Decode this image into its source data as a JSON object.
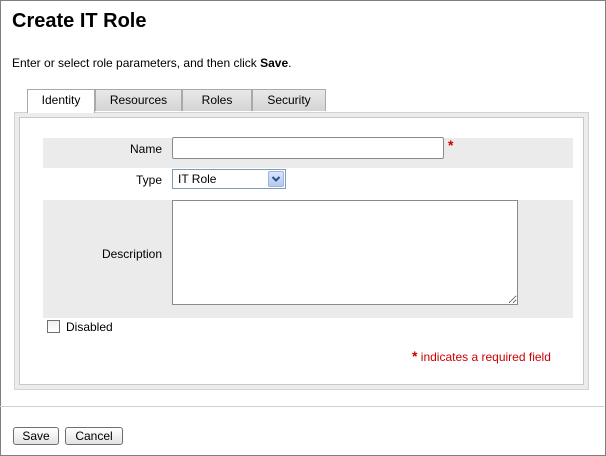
{
  "page": {
    "title": "Create IT Role",
    "instructions_prefix": "Enter or select role parameters, and then click ",
    "instructions_emphasis": "Save",
    "instructions_suffix": "."
  },
  "tabs": [
    {
      "label": "Identity",
      "active": true
    },
    {
      "label": "Resources",
      "active": false
    },
    {
      "label": "Roles",
      "active": false
    },
    {
      "label": "Security",
      "active": false
    }
  ],
  "form": {
    "name_label": "Name",
    "name_value": "",
    "required_marker": "*",
    "type_label": "Type",
    "type_value": "IT Role",
    "description_label": "Description",
    "description_value": "",
    "disabled_label": "Disabled",
    "disabled_checked": false,
    "required_note": "indicates a required field"
  },
  "buttons": {
    "save_label": "Save",
    "cancel_label": "Cancel"
  },
  "colors": {
    "required": "#cc0000",
    "row_shade": "#ebebeb",
    "panel_bg": "#ececec"
  }
}
